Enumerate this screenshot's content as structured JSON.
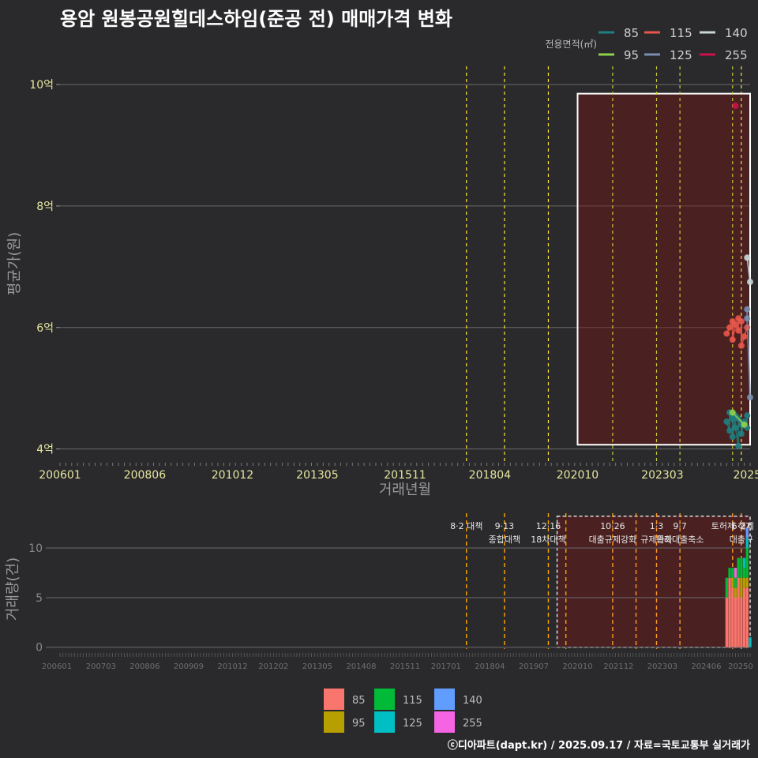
{
  "title": "용암 원봉공원힐데스하임(준공 전) 매매가격 변화",
  "credit": "ⓒ디아파트(dapt.kr) / 2025.09.17 / 자료=국토교통부 실거래가",
  "chart_data": [
    {
      "type": "scatter",
      "panel": "price",
      "xlabel": "거래년월",
      "ylabel": "평균가(원)",
      "ylim": [
        3.8,
        10.3
      ],
      "yticks": [
        4,
        6,
        8,
        10
      ],
      "ytick_labels": [
        "4억",
        "6억",
        "8억",
        "10억"
      ],
      "xlim": [
        "2006-01",
        "2025-09"
      ],
      "xticks": [
        "2006-01",
        "2008-06",
        "2010-12",
        "2013-05",
        "2015-11",
        "2018-04",
        "2020-10",
        "2023-03",
        "2025-08"
      ],
      "xtick_labels": [
        "200601",
        "200806",
        "201012",
        "201305",
        "201511",
        "201804",
        "202010",
        "202303",
        "2025"
      ],
      "grid": true,
      "legend_title": "전용면적(㎡)",
      "legend_position": "top-right",
      "series": [
        {
          "name": "85",
          "color": "#1f7f80",
          "points": [
            [
              "2025-01",
              4.45
            ],
            [
              "2025-02",
              4.3
            ],
            [
              "2025-02",
              4.6
            ],
            [
              "2025-03",
              4.5
            ],
            [
              "2025-03",
              4.2
            ],
            [
              "2025-04",
              4.55
            ],
            [
              "2025-04",
              4.35
            ],
            [
              "2025-05",
              4.05
            ],
            [
              "2025-05",
              4.5
            ],
            [
              "2025-06",
              4.4
            ],
            [
              "2025-06",
              4.25
            ],
            [
              "2025-07",
              4.45
            ],
            [
              "2025-08",
              4.35
            ],
            [
              "2025-08",
              4.55
            ]
          ]
        },
        {
          "name": "95",
          "color": "#8fd14f",
          "points": [
            [
              "2025-03",
              4.6
            ],
            [
              "2025-07",
              4.4
            ]
          ]
        },
        {
          "name": "115",
          "color": "#e8564a",
          "points": [
            [
              "2025-01",
              5.9
            ],
            [
              "2025-02",
              6.0
            ],
            [
              "2025-03",
              6.1
            ],
            [
              "2025-03",
              5.8
            ],
            [
              "2025-04",
              6.05
            ],
            [
              "2025-05",
              5.95
            ],
            [
              "2025-05",
              6.15
            ],
            [
              "2025-06",
              6.1
            ],
            [
              "2025-06",
              5.7
            ],
            [
              "2025-07",
              5.85
            ],
            [
              "2025-08",
              6.0
            ]
          ]
        },
        {
          "name": "125",
          "color": "#7a8fb0",
          "points": [
            [
              "2025-08",
              6.3
            ],
            [
              "2025-08",
              6.15
            ],
            [
              "2025-09",
              4.85
            ]
          ]
        },
        {
          "name": "140",
          "color": "#c8d6d8",
          "points": [
            [
              "2025-08",
              7.15
            ],
            [
              "2025-09",
              6.75
            ]
          ]
        },
        {
          "name": "255",
          "color": "#d0104c",
          "points": [
            [
              "2025-04",
              9.65
            ]
          ]
        }
      ],
      "highlight_box": {
        "from": "2020-10",
        "to": "2025-09",
        "ymin": 4.07,
        "ymax": 9.85
      },
      "event_lines": [
        {
          "date": "2017-08",
          "color": "#ffe23a"
        },
        {
          "date": "2018-09",
          "color": "#ffe23a"
        },
        {
          "date": "2019-12",
          "color": "#ffe23a"
        },
        {
          "date": "2021-10",
          "color": "#c8cc3a"
        },
        {
          "date": "2023-01",
          "color": "#c8cc3a"
        },
        {
          "date": "2023-09",
          "color": "#c8cc3a"
        },
        {
          "date": "2025-03",
          "color": "#c8cc3a"
        },
        {
          "date": "2025-06",
          "color": "#ffe23a"
        }
      ]
    },
    {
      "type": "bar",
      "panel": "volume",
      "ylabel": "거래량(건)",
      "ylim": [
        -0.5,
        13.5
      ],
      "yticks": [
        0,
        5,
        10
      ],
      "ytick_labels": [
        "0",
        "5",
        "10"
      ],
      "xlim": [
        "2006-01",
        "2025-09"
      ],
      "xticks": [
        "2006-01",
        "2007-03",
        "2008-06",
        "2009-09",
        "2010-12",
        "2012-02",
        "2013-05",
        "2014-08",
        "2015-11",
        "2017-01",
        "2018-04",
        "2019-07",
        "2020-10",
        "2021-12",
        "2023-03",
        "2024-06",
        "2025-09"
      ],
      "xtick_labels": [
        "200601",
        "200703",
        "200806",
        "200909",
        "201012",
        "201202",
        "201305",
        "201408",
        "201511",
        "201701",
        "201804",
        "201907",
        "202010",
        "202112",
        "202303",
        "202406",
        "20250"
      ],
      "legend_position": "bottom",
      "series": [
        {
          "name": "85",
          "color": "#f8766d"
        },
        {
          "name": "95",
          "color": "#b79f00"
        },
        {
          "name": "115",
          "color": "#00ba38"
        },
        {
          "name": "125",
          "color": "#00bfc4"
        },
        {
          "name": "140",
          "color": "#619cff"
        },
        {
          "name": "255",
          "color": "#f564e3"
        }
      ],
      "bars": [
        {
          "date": "2025-01",
          "stack": {
            "85": 5,
            "95": 0,
            "115": 2,
            "125": 0,
            "140": 0,
            "255": 0
          }
        },
        {
          "date": "2025-02",
          "stack": {
            "85": 7,
            "95": 0,
            "115": 1,
            "125": 0,
            "140": 0,
            "255": 0
          }
        },
        {
          "date": "2025-03",
          "stack": {
            "85": 6,
            "95": 1,
            "115": 1,
            "125": 0,
            "140": 0,
            "255": 0
          }
        },
        {
          "date": "2025-04",
          "stack": {
            "85": 5,
            "95": 1,
            "115": 1,
            "125": 0,
            "140": 0,
            "255": 1
          }
        },
        {
          "date": "2025-05",
          "stack": {
            "85": 7,
            "95": 0,
            "115": 2,
            "125": 0,
            "140": 0,
            "255": 0
          }
        },
        {
          "date": "2025-06",
          "stack": {
            "85": 5,
            "95": 2,
            "115": 2,
            "125": 0,
            "140": 0,
            "255": 0
          }
        },
        {
          "date": "2025-07",
          "stack": {
            "85": 6,
            "95": 1,
            "115": 1,
            "125": 1,
            "140": 0,
            "255": 0
          }
        },
        {
          "date": "2025-08",
          "stack": {
            "85": 6,
            "95": 1,
            "115": 3,
            "125": 1,
            "140": 1,
            "255": 0
          }
        },
        {
          "date": "2025-09",
          "stack": {
            "85": 0,
            "95": 0,
            "115": 0,
            "125": 1,
            "140": 0,
            "255": 0
          }
        }
      ],
      "highlight_box": {
        "from": "2020-03",
        "to": "2025-09",
        "ymin": 0,
        "ymax": 13.2
      },
      "event_lines": [
        {
          "date": "2017-08",
          "label": "8·2 대책",
          "color": "#ffa500"
        },
        {
          "date": "2018-09",
          "label": "9·13\n종합대책",
          "color": "#ffa500"
        },
        {
          "date": "2019-12",
          "label": "12·16\n18차대책",
          "color": "#ffa500"
        },
        {
          "date": "2020-06",
          "label": "",
          "color": "#ffa500"
        },
        {
          "date": "2021-10",
          "label": "10·26\n대출규제강화",
          "color": "#ff9a2a"
        },
        {
          "date": "2022-06",
          "label": "",
          "color": "#ff9a2a"
        },
        {
          "date": "2023-01",
          "label": "1·3\n규제완화",
          "color": "#ff9a2a"
        },
        {
          "date": "2023-09",
          "label": "9·7\n특례대출축소",
          "color": "#ff9a2a"
        },
        {
          "date": "2025-03",
          "label": "토허제 해제",
          "color": "#ff9a2a"
        },
        {
          "date": "2025-06",
          "label": "6·27\n대출규",
          "color": "#ff9a2a"
        }
      ]
    }
  ]
}
